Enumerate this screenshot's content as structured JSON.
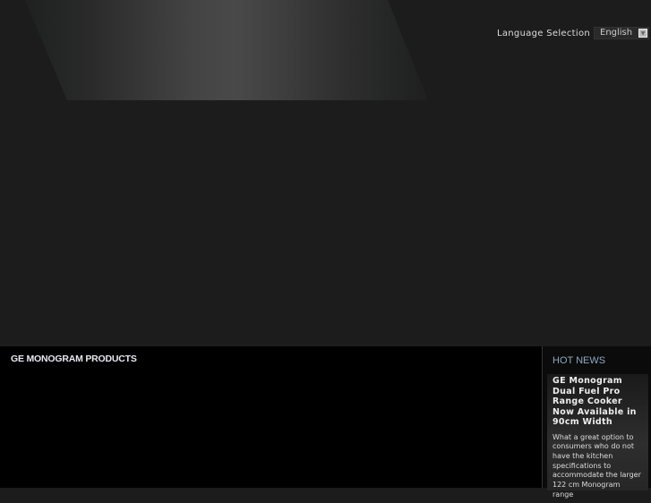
{
  "header": {
    "language_label": "Language Selection",
    "language_value": "English"
  },
  "main": {
    "products_title": "GE MONOGRAM PRODUCTS"
  },
  "sidebar": {
    "title": "HOT NEWS",
    "news": {
      "title": "GE Monogram Dual Fuel Pro Range Cooker Now Available in 90cm Width",
      "body": "What a great option to consumers who do not have the kitchen specifications to accommodate the larger 122 cm Monogram range"
    }
  }
}
